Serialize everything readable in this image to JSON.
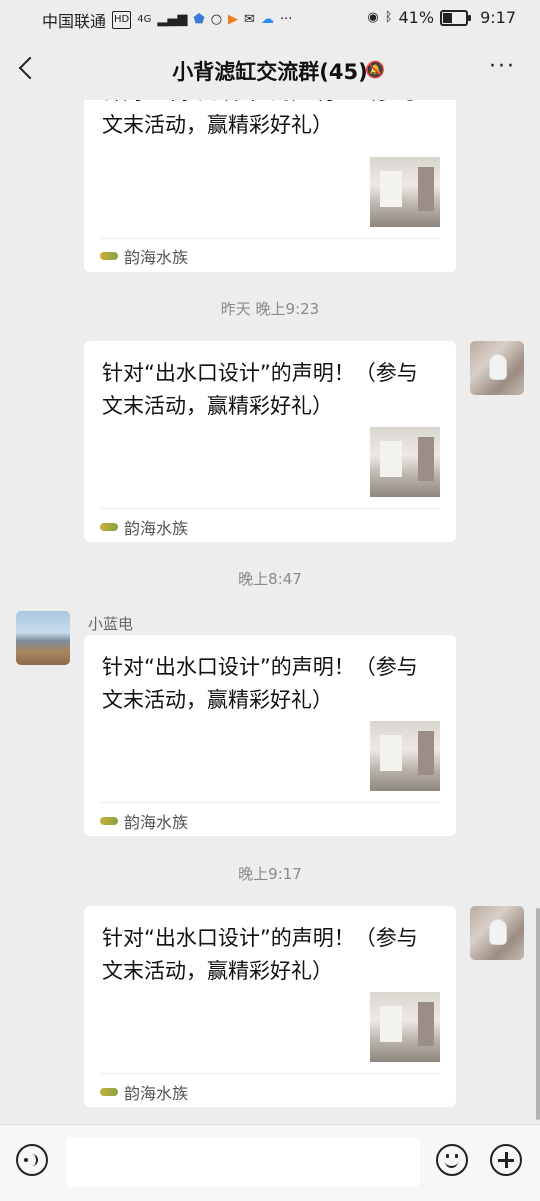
{
  "status_bar": {
    "carrier": "中国联通",
    "signal_badge": "HD",
    "network": "4G",
    "battery_percent": "41%",
    "time": "9:17",
    "icons": [
      "shield-icon",
      "circle-icon",
      "play-icon",
      "mail-icon",
      "cloud-icon",
      "more-dots-icon",
      "eye-icon",
      "bluetooth-icon",
      "battery-icon"
    ]
  },
  "header": {
    "back_icon": "chevron-left-icon",
    "title": "小背滤缸交流群(45)",
    "mute_icon": "bell-off-icon",
    "more_label": "···"
  },
  "messages": [
    {
      "type": "link_card",
      "sender": "self",
      "title": "针对“出水口设计”的声明！（参与文末活动，赢精彩好礼）",
      "source": "韵海水族"
    },
    {
      "type": "time",
      "text": "昨天 晚上9:23"
    },
    {
      "type": "link_card",
      "sender": "self",
      "title": "针对“出水口设计”的声明！（参与文末活动，赢精彩好礼）",
      "source": "韵海水族"
    },
    {
      "type": "time",
      "text": "晚上8:47"
    },
    {
      "type": "link_card",
      "sender": "other",
      "sender_name": "小蓝电",
      "title": "针对“出水口设计”的声明！（参与文末活动，赢精彩好礼）",
      "source": "韵海水族"
    },
    {
      "type": "time",
      "text": "晚上9:17"
    },
    {
      "type": "link_card",
      "sender": "self",
      "title": "针对“出水口设计”的声明！（参与文末活动，赢精彩好礼）",
      "source": "韵海水族"
    }
  ],
  "input_bar": {
    "voice_icon": "voice-icon",
    "input_value": "",
    "emoji_icon": "emoji-icon",
    "plus_icon": "plus-icon"
  }
}
